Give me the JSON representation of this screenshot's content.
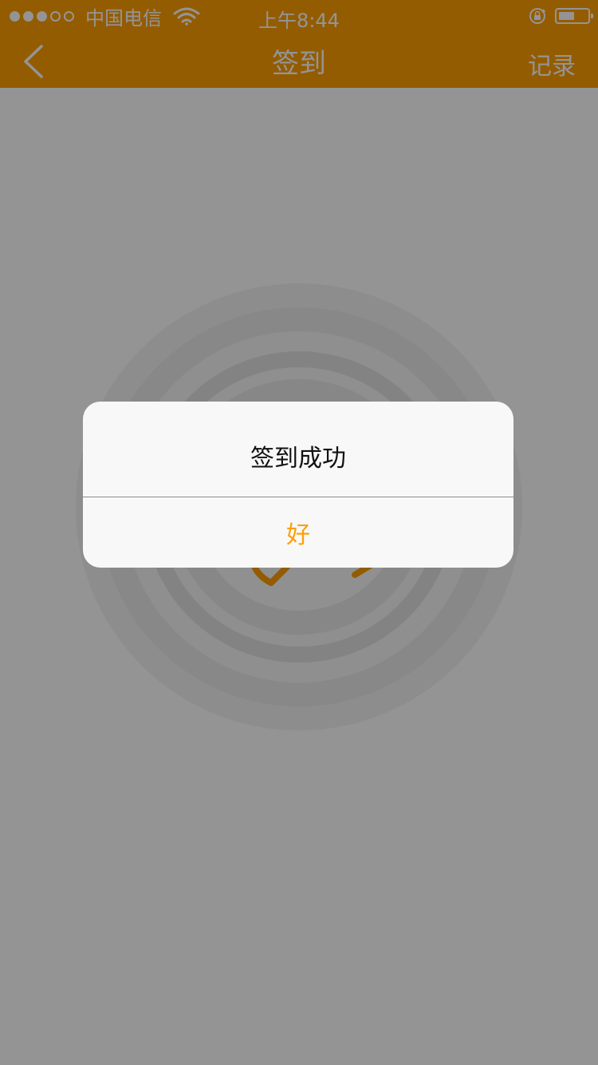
{
  "colors": {
    "accent": "#FF9F00",
    "header_text": "#FFFFFF",
    "alert_bg": "#F8F8F8",
    "overlay": "rgba(0,0,0,0.42)"
  },
  "status_bar": {
    "signal_bars_filled": 3,
    "signal_bars_total": 5,
    "carrier": "中国电信",
    "time": "上午8:44",
    "icons": [
      "wifi-icon",
      "orientation-lock-icon",
      "battery-icon"
    ],
    "battery_level": 0.55
  },
  "navbar": {
    "back_icon": "chevron-left-icon",
    "title": "签到",
    "right_action": "记录"
  },
  "content": {
    "illustration": "thumbs-up-hand-icon"
  },
  "alert": {
    "title": "签到成功",
    "button_label": "好"
  }
}
